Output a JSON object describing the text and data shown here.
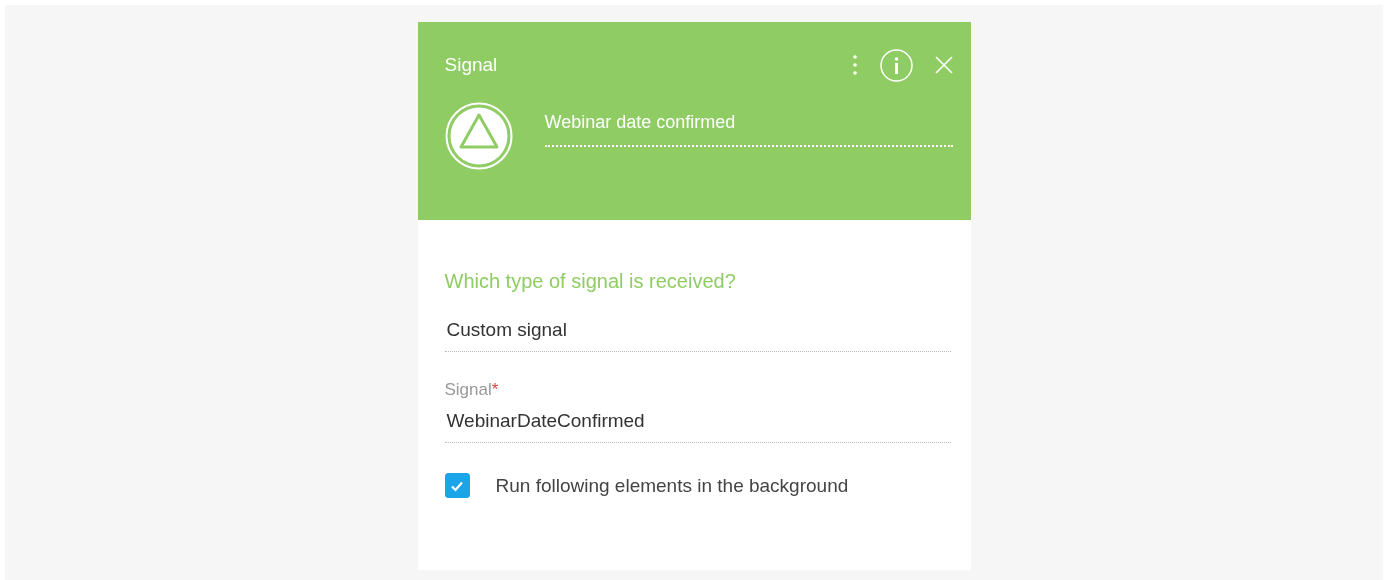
{
  "panel": {
    "title": "Signal",
    "element_name": "Webinar date confirmed"
  },
  "question": "Which type of signal is received?",
  "fields": [
    {
      "kind": "plain",
      "value": "Custom signal"
    },
    {
      "kind": "labeled",
      "label": "Signal",
      "required_mark": "*",
      "value": "WebinarDateConfirmed"
    }
  ],
  "background_option": {
    "label": "Run following elements in the background",
    "checked": true
  }
}
